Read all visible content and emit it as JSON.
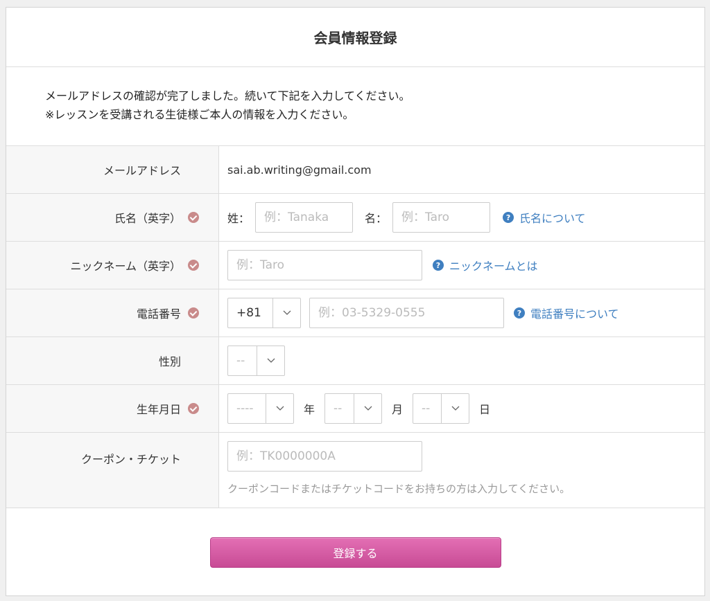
{
  "page": {
    "title": "会員情報登録"
  },
  "intro": {
    "line1": "メールアドレスの確認が完了しました。続いて下記を入力してください。",
    "line2": "※レッスンを受講される生徒様ご本人の情報を入力ください。"
  },
  "form": {
    "email": {
      "label": "メールアドレス",
      "value": "sai.ab.writing@gmail.com"
    },
    "name": {
      "label": "氏名（英字）",
      "last_label": "姓：",
      "last_placeholder": "例：Tanaka",
      "first_label": "名：",
      "first_placeholder": "例：Taro",
      "help": "氏名について"
    },
    "nickname": {
      "label": "ニックネーム（英字）",
      "placeholder": "例：Taro",
      "help": "ニックネームとは"
    },
    "phone": {
      "label": "電話番号",
      "country_code": "+81",
      "placeholder": "例：03-5329-0555",
      "help": "電話番号について"
    },
    "gender": {
      "label": "性別",
      "value": "--"
    },
    "birthday": {
      "label": "生年月日",
      "year_value": "----",
      "year_unit": "年",
      "month_value": "--",
      "month_unit": "月",
      "day_value": "--",
      "day_unit": "日"
    },
    "coupon": {
      "label": "クーポン・チケット",
      "placeholder": "例：TK0000000A",
      "note": "クーポンコードまたはチケットコードをお持ちの方は入力してください。"
    }
  },
  "submit": {
    "label": "登録する"
  },
  "icons": {
    "required": "check-circle-icon",
    "help": "question-circle-icon",
    "dropdown": "chevron-down-icon"
  },
  "colors": {
    "accent": "#d85aa5",
    "link": "#3f7fc0",
    "required": "#c98b8b"
  }
}
